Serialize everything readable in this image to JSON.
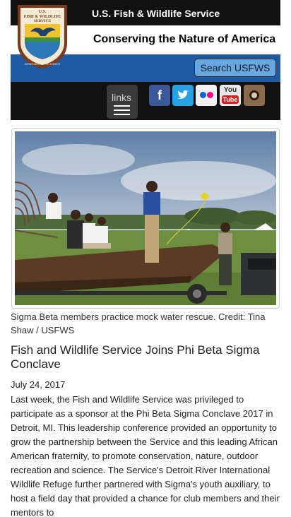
{
  "header": {
    "logo_lines": [
      "U.S.",
      "FISH & WILDLIFE",
      "SERVICE",
      "DEPARTMENT OF THE INTERIOR"
    ],
    "agency_name": "U.S. Fish & Wildlife Service",
    "tagline": "Conserving the Nature of America",
    "search_label": "Search USFWS",
    "links_label": "links"
  },
  "social": [
    {
      "name": "facebook",
      "glyph": "f"
    },
    {
      "name": "twitter",
      "glyph": "t"
    },
    {
      "name": "flickr",
      "glyph": ""
    },
    {
      "name": "youtube",
      "you": "You",
      "tube": "Tube"
    },
    {
      "name": "instagram",
      "glyph": ""
    }
  ],
  "article": {
    "image_caption": "Sigma Beta members practice mock water rescue. Credit: Tina Shaw / USFWS",
    "title": "Fish and Wildlife Service Joins Phi Beta Sigma Conclave",
    "date": "July 24, 2017",
    "body": "Last week, the Fish and Wildlife Service was privileged to participate as a sponsor at the Phi Beta Sigma Conclave 2017 in Detroit, MI. This leadership conference provided an opportunity to grow the partnership between the Service and this leading African American fraternity, to promote conservation, nature, outdoor recreation and science. The Service's Detroit River International Wildlife Refuge further partnered with Sigma's youth auxiliary, to host a field day that provided a chance for club members and their mentors to"
  },
  "colors": {
    "brand_blue": "#1e5aa6",
    "search_button": "#6aa7dc",
    "header_black": "#111111"
  }
}
